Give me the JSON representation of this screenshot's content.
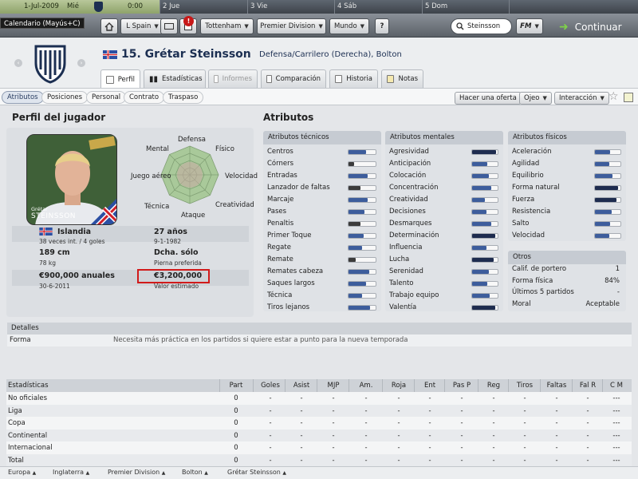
{
  "calendar": {
    "days": [
      {
        "num": "1-Jul-2009",
        "day": "Mié",
        "time": "0:00"
      },
      {
        "num": "2",
        "day": "Jue"
      },
      {
        "num": "3",
        "day": "Vie"
      },
      {
        "num": "4",
        "day": "Sáb"
      },
      {
        "num": "5",
        "day": "Dom"
      }
    ],
    "tooltip": "Calendario (Mayús+C)"
  },
  "topbar": {
    "club_menu": "L Spain",
    "notification_count": "!",
    "team_menu": "Tottenham",
    "league_menu": "Premier Division",
    "world_menu": "Mundo",
    "help": "?",
    "search_value": "Steinsson",
    "fm_menu": "FM",
    "continue_label": "Continuar"
  },
  "player": {
    "number_name": "15. Grétar Steinsson",
    "position_club": "Defensa/Carrilero (Derecha), Bolton",
    "photo_caption_first": "Grétar",
    "photo_caption_last": "STEINSSON",
    "nationality": "Islandia",
    "caps": "38 veces int. / 4 goles",
    "age": "27 años",
    "dob": "9-1-1982",
    "height": "189 cm",
    "weight": "78 kg",
    "foot": "Dcha. sólo",
    "foot_label": "Pierna preferida",
    "wage": "€900,000 anuales",
    "contract_end": "30-6-2011",
    "value": "€3,200,000",
    "value_label": "Valor estimado"
  },
  "tabs": [
    "Perfil",
    "Estadísticas",
    "Informes",
    "Comparación",
    "Historia",
    "Notas"
  ],
  "subtabs": [
    "Atributos",
    "Posiciones",
    "Personal",
    "Contrato",
    "Traspaso"
  ],
  "actions": {
    "offer": "Hacer una oferta",
    "scout": "Ojeo",
    "interaction": "Interacción"
  },
  "profile": {
    "title": "Perfil del jugador",
    "radar_labels": [
      "Defensa",
      "Físico",
      "Velocidad",
      "Creatividad",
      "Ataque",
      "Técnica",
      "Juego aéreo",
      "Mental"
    ]
  },
  "attributes": {
    "title": "Atributos",
    "technical": {
      "title": "Atributos técnicos",
      "items": [
        {
          "name": "Centros",
          "v": 0.65
        },
        {
          "name": "Córners",
          "v": 0.2
        },
        {
          "name": "Entradas",
          "v": 0.7
        },
        {
          "name": "Lanzador de faltas",
          "v": 0.45
        },
        {
          "name": "Marcaje",
          "v": 0.7
        },
        {
          "name": "Pases",
          "v": 0.6
        },
        {
          "name": "Penaltis",
          "v": 0.45
        },
        {
          "name": "Primer Toque",
          "v": 0.55
        },
        {
          "name": "Regate",
          "v": 0.5
        },
        {
          "name": "Remate",
          "v": 0.25
        },
        {
          "name": "Remates cabeza",
          "v": 0.75
        },
        {
          "name": "Saques largos",
          "v": 0.65
        },
        {
          "name": "Técnica",
          "v": 0.5
        },
        {
          "name": "Tiros lejanos",
          "v": 0.8
        }
      ]
    },
    "mental": {
      "title": "Atributos mentales",
      "items": [
        {
          "name": "Agresividad",
          "v": 0.95
        },
        {
          "name": "Anticipación",
          "v": 0.6
        },
        {
          "name": "Colocación",
          "v": 0.65
        },
        {
          "name": "Concentración",
          "v": 0.75
        },
        {
          "name": "Creatividad",
          "v": 0.5
        },
        {
          "name": "Decisiones",
          "v": 0.55
        },
        {
          "name": "Desmarques",
          "v": 0.75
        },
        {
          "name": "Determinación",
          "v": 0.9
        },
        {
          "name": "Influencia",
          "v": 0.55
        },
        {
          "name": "Lucha",
          "v": 0.85
        },
        {
          "name": "Serenidad",
          "v": 0.65
        },
        {
          "name": "Talento",
          "v": 0.6
        },
        {
          "name": "Trabajo equipo",
          "v": 0.7
        },
        {
          "name": "Valentía",
          "v": 0.9
        }
      ]
    },
    "physical": {
      "title": "Atributos físicos",
      "items": [
        {
          "name": "Aceleración",
          "v": 0.6
        },
        {
          "name": "Agilidad",
          "v": 0.55
        },
        {
          "name": "Equilibrio",
          "v": 0.7
        },
        {
          "name": "Forma natural",
          "v": 0.9
        },
        {
          "name": "Fuerza",
          "v": 0.85
        },
        {
          "name": "Resistencia",
          "v": 0.65
        },
        {
          "name": "Salto",
          "v": 0.6
        },
        {
          "name": "Velocidad",
          "v": 0.55
        }
      ]
    },
    "other": {
      "title": "Otros",
      "items": [
        {
          "name": "Calif. de portero",
          "value": "1"
        },
        {
          "name": "Forma física",
          "value": "84%"
        },
        {
          "name": "Últimos 5 partidos",
          "value": "-"
        },
        {
          "name": "Moral",
          "value": "Aceptable"
        }
      ]
    }
  },
  "details": {
    "title": "Detalles",
    "label": "Forma",
    "text": "Necesita más práctica en los partidos si quiere estar a punto para la nueva temporada"
  },
  "stats": {
    "headers": [
      "Estadísticas",
      "Part",
      "Goles",
      "Asist",
      "MJP",
      "Am.",
      "Roja",
      "Ent",
      "Pas P",
      "Reg",
      "Tiros",
      "Faltas",
      "Fal R",
      "C M"
    ],
    "rows": [
      {
        "name": "No oficiales",
        "cells": [
          "0",
          "-",
          "-",
          "-",
          "-",
          "-",
          "-",
          "-",
          "-",
          "-",
          "-",
          "-",
          "---"
        ]
      },
      {
        "name": "Liga",
        "cells": [
          "0",
          "-",
          "-",
          "-",
          "-",
          "-",
          "-",
          "-",
          "-",
          "-",
          "-",
          "-",
          "---"
        ]
      },
      {
        "name": "Copa",
        "cells": [
          "0",
          "-",
          "-",
          "-",
          "-",
          "-",
          "-",
          "-",
          "-",
          "-",
          "-",
          "-",
          "---"
        ]
      },
      {
        "name": "Continental",
        "cells": [
          "0",
          "-",
          "-",
          "-",
          "-",
          "-",
          "-",
          "-",
          "-",
          "-",
          "-",
          "-",
          "---"
        ]
      },
      {
        "name": "Internacional",
        "cells": [
          "0",
          "-",
          "-",
          "-",
          "-",
          "-",
          "-",
          "-",
          "-",
          "-",
          "-",
          "-",
          "---"
        ]
      },
      {
        "name": "Total",
        "cells": [
          "0",
          "-",
          "-",
          "-",
          "-",
          "-",
          "-",
          "-",
          "-",
          "-",
          "-",
          "-",
          "---"
        ]
      }
    ]
  },
  "breadcrumb": [
    "Europa",
    "Inglaterra",
    "Premier Division",
    "Bolton",
    "Grétar Steinsson"
  ],
  "colors": {
    "bar_blue": "#3d5d9c",
    "bar_dark": "#3b3b3b",
    "bar_navy": "#1e2c4f",
    "accent": "#1c2f52"
  }
}
